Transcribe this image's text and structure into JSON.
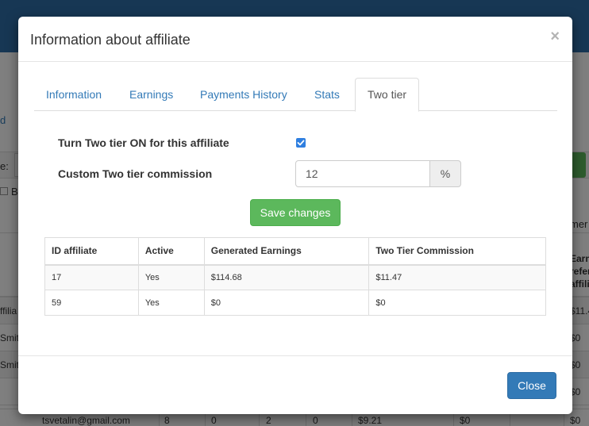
{
  "background": {
    "link_fragment": "d",
    "filter_label_fragment": "e:",
    "checkbox_label_fragment": "B",
    "column_fragment": "mer",
    "side_header_fragment": "Earn refer affili",
    "rows": [
      {
        "left": "ffilia",
        "right": "$11.4"
      },
      {
        "left": "Smith",
        "right": "$0"
      },
      {
        "left": "Smith",
        "right": "$0"
      },
      {
        "left": "",
        "right": "$0"
      }
    ],
    "bottom_row": {
      "email": "tsvetalin@gmail.com",
      "c1": "8",
      "c2": "0",
      "c3": "2",
      "c4": "0",
      "c5": "$9.21",
      "c6": "$0",
      "c7": "$0"
    }
  },
  "modal": {
    "title": "Information about affiliate",
    "close_x": "×",
    "tabs": [
      {
        "label": "Information"
      },
      {
        "label": "Earnings"
      },
      {
        "label": "Payments History"
      },
      {
        "label": "Stats"
      },
      {
        "label": "Two tier"
      }
    ],
    "active_tab": "Two tier",
    "form": {
      "toggle_label": "Turn Two tier ON for this affiliate",
      "toggle_checked": true,
      "commission_label": "Custom Two tier commission",
      "commission_value": "12",
      "commission_unit": "%",
      "save_label": "Save changes"
    },
    "table": {
      "headers": [
        "ID affiliate",
        "Active",
        "Generated Earnings",
        "Two Tier Commission"
      ],
      "rows": [
        [
          "17",
          "Yes",
          "$114.68",
          "$11.47"
        ],
        [
          "59",
          "Yes",
          "$0",
          "$0"
        ]
      ]
    },
    "footer": {
      "close_label": "Close"
    }
  },
  "colors": {
    "primary": "#337ab7",
    "success": "#5cb85c",
    "checkbox": "#2f7fe0",
    "backdrop": "rgba(0,0,0,0.5)"
  }
}
